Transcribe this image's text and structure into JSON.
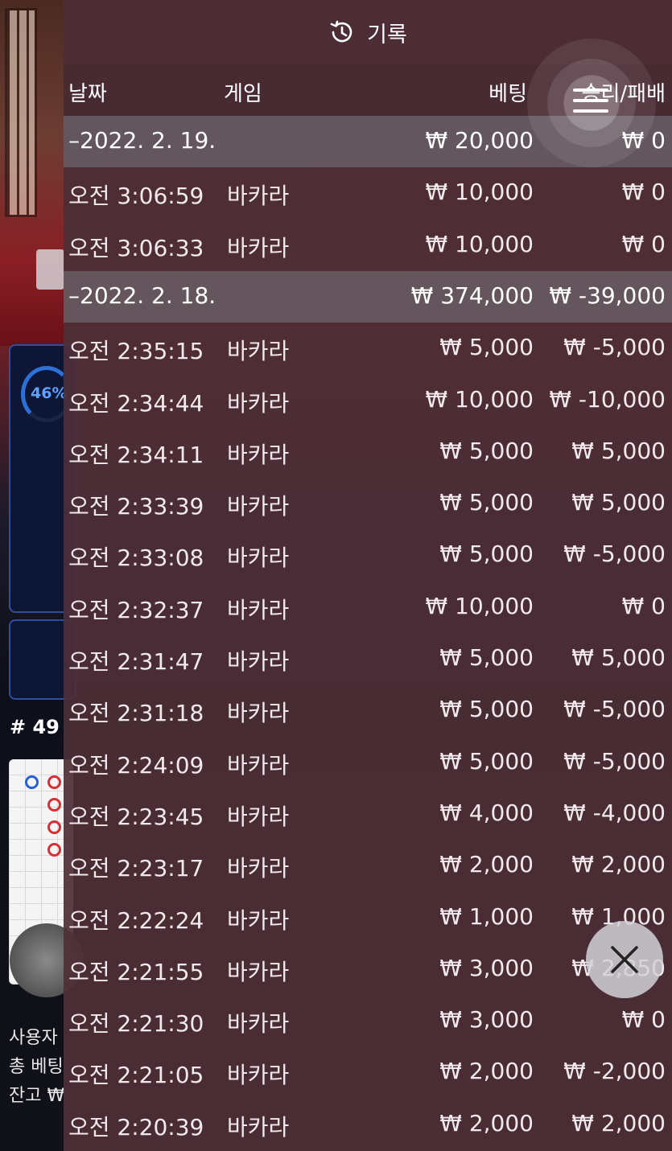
{
  "background": {
    "progress_percent": "46%",
    "round_label": "# 49",
    "user_label": "사용자",
    "total_bet_label": "총 베팅",
    "balance_label": "잔고 ₩"
  },
  "history": {
    "title": "기록",
    "title_icon": "history-icon",
    "columns": {
      "date": "날짜",
      "game": "게임",
      "bet": "베팅",
      "result": "승리/패배"
    },
    "rows": [
      {
        "type": "date",
        "time": "–2022. 2. 19.",
        "game": "",
        "bet": "₩ 20,000",
        "result": "₩ 0"
      },
      {
        "type": "entry",
        "time": "오전 3:06:59",
        "game": "바카라",
        "bet": "₩ 10,000",
        "result": "₩ 0"
      },
      {
        "type": "entry",
        "time": "오전 3:06:33",
        "game": "바카라",
        "bet": "₩ 10,000",
        "result": "₩ 0"
      },
      {
        "type": "date",
        "time": "–2022. 2. 18.",
        "game": "",
        "bet": "₩ 374,000",
        "result": "₩ -39,000"
      },
      {
        "type": "entry",
        "time": "오전 2:35:15",
        "game": "바카라",
        "bet": "₩ 5,000",
        "result": "₩ -5,000"
      },
      {
        "type": "entry",
        "time": "오전 2:34:44",
        "game": "바카라",
        "bet": "₩ 10,000",
        "result": "₩ -10,000"
      },
      {
        "type": "entry",
        "time": "오전 2:34:11",
        "game": "바카라",
        "bet": "₩ 5,000",
        "result": "₩ 5,000"
      },
      {
        "type": "entry",
        "time": "오전 2:33:39",
        "game": "바카라",
        "bet": "₩ 5,000",
        "result": "₩ 5,000"
      },
      {
        "type": "entry",
        "time": "오전 2:33:08",
        "game": "바카라",
        "bet": "₩ 5,000",
        "result": "₩ -5,000"
      },
      {
        "type": "entry",
        "time": "오전 2:32:37",
        "game": "바카라",
        "bet": "₩ 10,000",
        "result": "₩ 0"
      },
      {
        "type": "entry",
        "time": "오전 2:31:47",
        "game": "바카라",
        "bet": "₩ 5,000",
        "result": "₩ 5,000"
      },
      {
        "type": "entry",
        "time": "오전 2:31:18",
        "game": "바카라",
        "bet": "₩ 5,000",
        "result": "₩ -5,000"
      },
      {
        "type": "entry",
        "time": "오전 2:24:09",
        "game": "바카라",
        "bet": "₩ 5,000",
        "result": "₩ -5,000"
      },
      {
        "type": "entry",
        "time": "오전 2:23:45",
        "game": "바카라",
        "bet": "₩ 4,000",
        "result": "₩ -4,000"
      },
      {
        "type": "entry",
        "time": "오전 2:23:17",
        "game": "바카라",
        "bet": "₩ 2,000",
        "result": "₩ 2,000"
      },
      {
        "type": "entry",
        "time": "오전 2:22:24",
        "game": "바카라",
        "bet": "₩ 1,000",
        "result": "₩ 1,000"
      },
      {
        "type": "entry",
        "time": "오전 2:21:55",
        "game": "바카라",
        "bet": "₩ 3,000",
        "result": "₩ 2,850"
      },
      {
        "type": "entry",
        "time": "오전 2:21:30",
        "game": "바카라",
        "bet": "₩ 3,000",
        "result": "₩ 0"
      },
      {
        "type": "entry",
        "time": "오전 2:21:05",
        "game": "바카라",
        "bet": "₩ 2,000",
        "result": "₩ -2,000"
      },
      {
        "type": "entry",
        "time": "오전 2:20:39",
        "game": "바카라",
        "bet": "₩ 2,000",
        "result": "₩ 2,000"
      }
    ]
  },
  "controls": {
    "menu_icon": "hamburger-menu-icon",
    "close_icon": "close-icon"
  }
}
